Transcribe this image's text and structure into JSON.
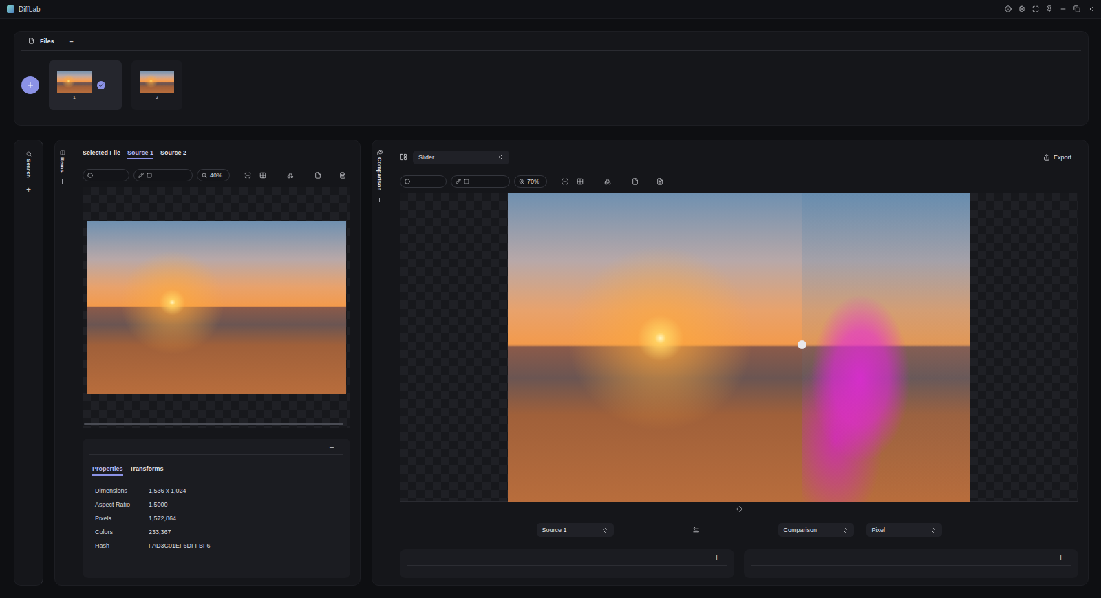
{
  "window": {
    "title": "DiffLab"
  },
  "files": {
    "title": "Files",
    "collapse": "–",
    "items": [
      {
        "label": "1",
        "selected": true
      },
      {
        "label": "2",
        "selected": false
      }
    ]
  },
  "sidebar": {
    "label": "Search",
    "add": "+"
  },
  "items_panel": {
    "label": "Items",
    "tabs": [
      {
        "label": "Selected File",
        "selected": false
      },
      {
        "label": "Source 1",
        "selected": true
      },
      {
        "label": "Source 2",
        "selected": false
      }
    ],
    "zoom": "40%",
    "properties": {
      "collapse": "–",
      "tabs": [
        {
          "label": "Properties",
          "selected": true
        },
        {
          "label": "Transforms",
          "selected": false
        }
      ],
      "rows": [
        {
          "label": "Dimensions",
          "value": "1,536 x 1,024"
        },
        {
          "label": "Aspect Ratio",
          "value": "1.5000"
        },
        {
          "label": "Pixels",
          "value": "1,572,864"
        },
        {
          "label": "Colors",
          "value": "233,367"
        },
        {
          "label": "Hash",
          "value": "FAD3C01EF6DFFBF6"
        }
      ]
    }
  },
  "comparison": {
    "label": "Comparison",
    "mode": "Slider",
    "export": "Export",
    "zoom": "70%",
    "slider": {
      "level": 0.635
    },
    "left_source": "Source 1",
    "right_source": "Comparison",
    "method": "Pixel",
    "panels": [
      {
        "add": "+"
      },
      {
        "add": "+"
      }
    ]
  }
}
